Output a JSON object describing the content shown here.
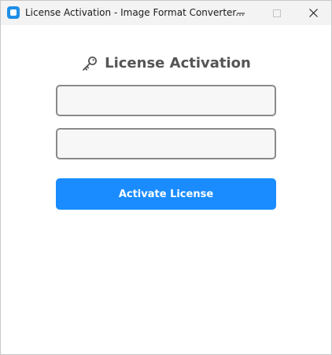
{
  "window": {
    "title": "License Activation - Image Format Converter...",
    "icon": "app-icon",
    "controls": [
      "minimize-icon",
      "maximize-icon",
      "close-icon"
    ]
  },
  "main": {
    "heading": "License Activation",
    "heading_icon": "key-icon",
    "fields": [
      {
        "value": "",
        "placeholder": ""
      },
      {
        "value": "",
        "placeholder": ""
      }
    ],
    "activate_label": "Activate License"
  },
  "colors": {
    "accent": "#1a8cff",
    "heading_text": "#555555",
    "field_border": "#8a8a8a",
    "field_background": "#f7f7f7",
    "titlebar": "#f3f3f3"
  }
}
